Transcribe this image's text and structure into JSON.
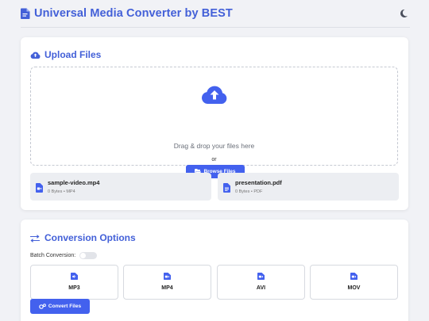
{
  "header": {
    "title": "Universal Media Converter by BEST",
    "logo_icon": "file-icon",
    "theme_icon": "moon-icon"
  },
  "upload": {
    "title": "Upload Files",
    "dropzone": {
      "text": "Drag & drop your files here",
      "or": "or",
      "browse_label": "Browse Files"
    },
    "files": [
      {
        "name": "sample-video.mp4",
        "meta": "0 Bytes • MP4",
        "icon": "video-file-icon"
      },
      {
        "name": "presentation.pdf",
        "meta": "0 Bytes • PDF",
        "icon": "document-file-icon"
      }
    ]
  },
  "conversion": {
    "title": "Conversion Options",
    "batch_label": "Batch Conversion:",
    "batch_enabled": false,
    "formats": [
      {
        "label": "MP3",
        "icon": "audio-file-icon"
      },
      {
        "label": "MP4",
        "icon": "video-file-icon"
      },
      {
        "label": "AVI",
        "icon": "video-file-icon"
      },
      {
        "label": "MOV",
        "icon": "video-file-icon"
      }
    ],
    "convert_label": "Convert Files"
  },
  "colors": {
    "accent": "#4361ee",
    "title": "#4360d8",
    "background": "#f1f2f6"
  }
}
